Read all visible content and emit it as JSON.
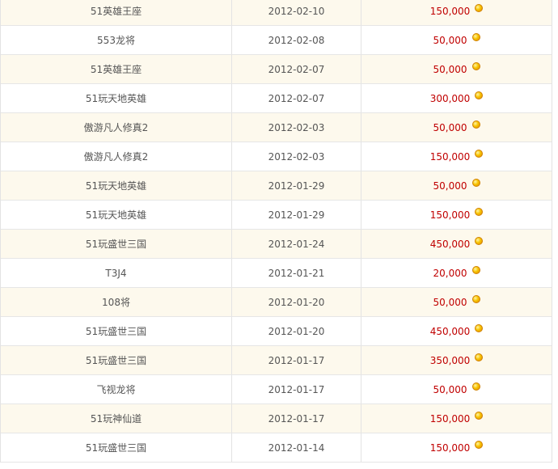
{
  "rows": [
    {
      "game": "51英雄王座",
      "date": "2012-02-10",
      "amount": "150,000"
    },
    {
      "game": "553龙将",
      "date": "2012-02-08",
      "amount": "50,000"
    },
    {
      "game": "51英雄王座",
      "date": "2012-02-07",
      "amount": "50,000"
    },
    {
      "game": "51玩天地英雄",
      "date": "2012-02-07",
      "amount": "300,000"
    },
    {
      "game": "傲游凡人修真2",
      "date": "2012-02-03",
      "amount": "50,000"
    },
    {
      "game": "傲游凡人修真2",
      "date": "2012-02-03",
      "amount": "150,000"
    },
    {
      "game": "51玩天地英雄",
      "date": "2012-01-29",
      "amount": "50,000"
    },
    {
      "game": "51玩天地英雄",
      "date": "2012-01-29",
      "amount": "150,000"
    },
    {
      "game": "51玩盛世三国",
      "date": "2012-01-24",
      "amount": "450,000"
    },
    {
      "game": "T3J4",
      "date": "2012-01-21",
      "amount": "20,000"
    },
    {
      "game": "108将",
      "date": "2012-01-20",
      "amount": "50,000"
    },
    {
      "game": "51玩盛世三国",
      "date": "2012-01-20",
      "amount": "450,000"
    },
    {
      "game": "51玩盛世三国",
      "date": "2012-01-17",
      "amount": "350,000"
    },
    {
      "game": "飞视龙将",
      "date": "2012-01-17",
      "amount": "50,000"
    },
    {
      "game": "51玩神仙道",
      "date": "2012-01-17",
      "amount": "150,000"
    },
    {
      "game": "51玩盛世三国",
      "date": "2012-01-14",
      "amount": "150,000"
    }
  ],
  "icons": {
    "amount_icon": "gold-coin-icon"
  },
  "colors": {
    "amount_text": "#c00000",
    "row_alt_bg": "#fdf9ed",
    "border": "#e3e3e3"
  }
}
